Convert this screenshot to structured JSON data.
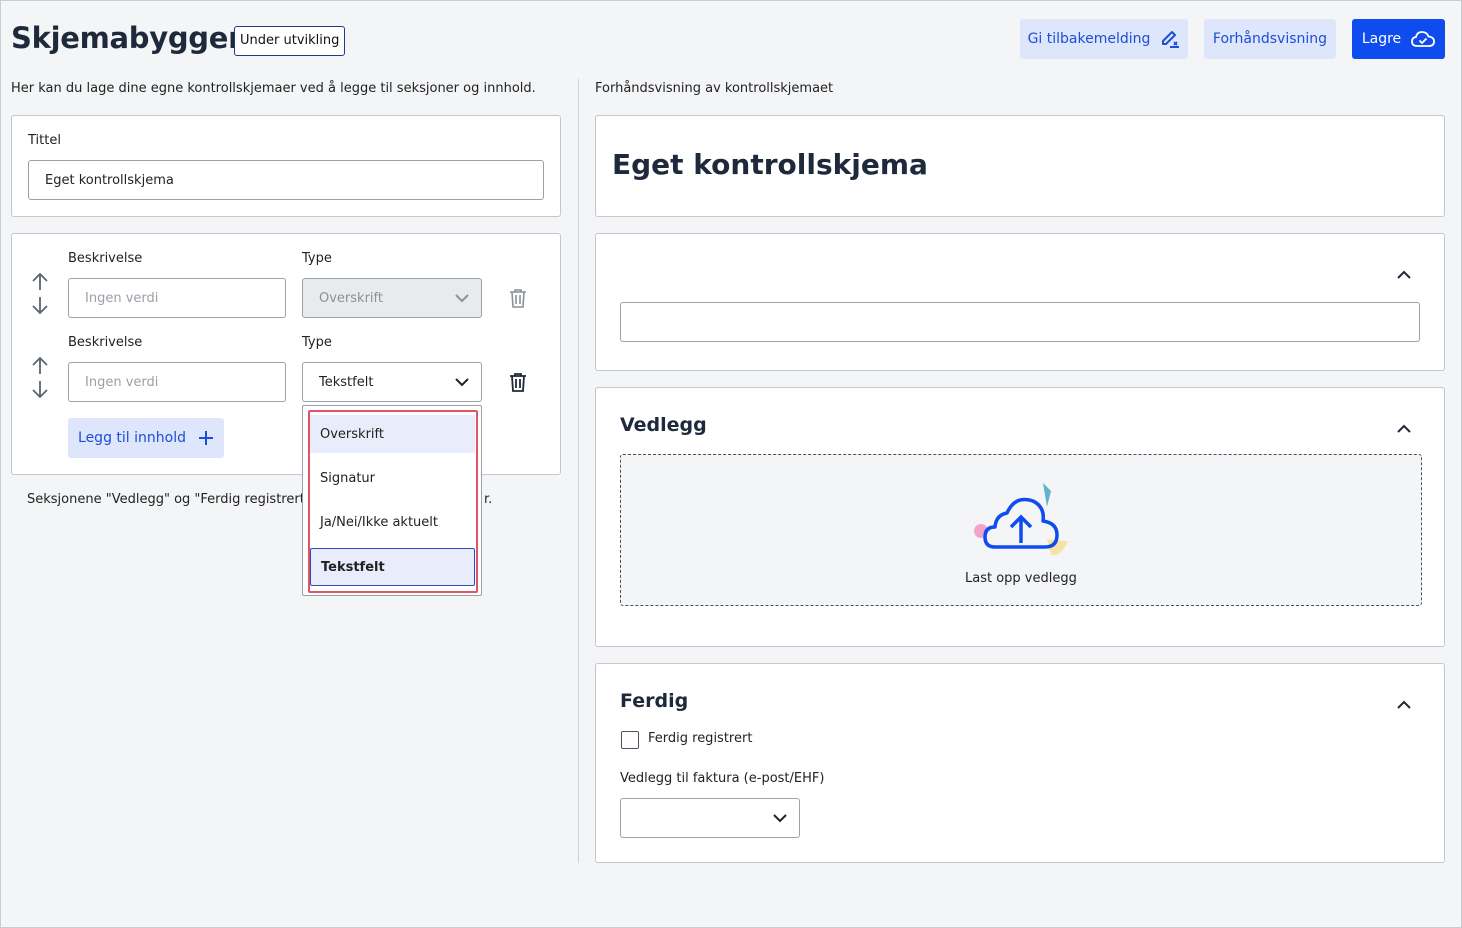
{
  "header": {
    "title": "Skjemabygger",
    "badge": "Under utvikling",
    "feedback_label": "Gi tilbakemelding",
    "preview_label": "Forhåndsvisning",
    "save_label": "Lagre"
  },
  "builder": {
    "intro": "Her kan du lage dine egne kontrollskjemaer ved å legge til seksjoner og innhold.",
    "title_label": "Tittel",
    "title_value": "Eget kontrollskjema",
    "rows": [
      {
        "desc_label": "Beskrivelse",
        "desc_placeholder": "Ingen verdi",
        "type_label": "Type",
        "type_value": "Overskrift"
      },
      {
        "desc_label": "Beskrivelse",
        "desc_placeholder": "Ingen verdi",
        "type_label": "Type",
        "type_value": "Tekstfelt"
      }
    ],
    "add_content_label": "Legg til innhold",
    "note_start": "Seksjonene \"Vedlegg\" og \"Ferdig registrert",
    "note_end": "r."
  },
  "dropdown": {
    "options": [
      "Overskrift",
      "Signatur",
      "Ja/Nei/Ikke aktuelt",
      "Tekstfelt"
    ],
    "selected": "Tekstfelt"
  },
  "preview": {
    "heading": "Forhåndsvisning av kontrollskjemaet",
    "form_title": "Eget kontrollskjema",
    "attachments_title": "Vedlegg",
    "upload_label": "Last opp vedlegg",
    "done_title": "Ferdig",
    "done_checkbox_label": "Ferdig registrert",
    "invoice_label": "Vedlegg til faktura (e-post/EHF)"
  },
  "colors": {
    "primary": "#0f4cf0",
    "light_button": "#dde6fb",
    "highlight": "#e05468"
  }
}
